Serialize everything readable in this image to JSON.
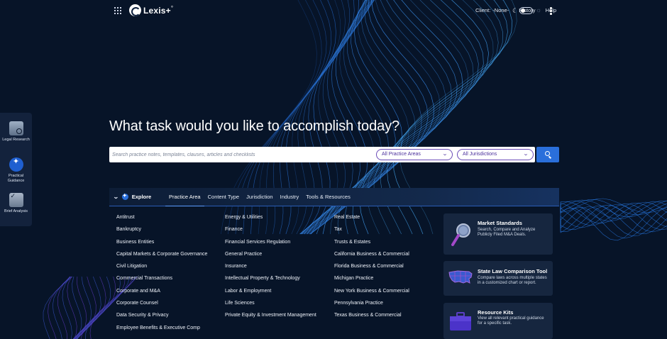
{
  "app": {
    "name": "Lexis+",
    "logo_sup": "°"
  },
  "topnav": {
    "client_label": "Client:",
    "client_value": "-None-",
    "history": "History",
    "help": "Help"
  },
  "rail": {
    "legal": "Legal Research",
    "practical": "Practical Guidance",
    "brief": "Brief Analysis"
  },
  "hero": {
    "title": "What task would you like to accomplish today?"
  },
  "search": {
    "placeholder": "Search practice notes, templates, clauses, articles and checklists",
    "practice_areas": "All Practice Areas",
    "jurisdictions": "All Jurisdictions"
  },
  "explore": {
    "label": "Explore",
    "tabs": [
      "Practice Area",
      "Content Type",
      "Jurisdiction",
      "Industry",
      "Tools & Resources"
    ]
  },
  "practice_areas": {
    "col1": [
      "Antitrust",
      "Bankruptcy",
      "Business Entities",
      "Capital Markets & Corporate Governance",
      "Civil Litigation",
      "Commercial Transactions",
      "Corporate and M&A",
      "Corporate Counsel",
      "Data Security & Privacy",
      "Employee Benefits & Executive Comp"
    ],
    "col2": [
      "Energy & Utilities",
      "Finance",
      "Financial Services Regulation",
      "General Practice",
      "Insurance",
      "Intellectual Property & Technology",
      "Labor & Employment",
      "Life Sciences",
      "Private Equity & Investment Management"
    ],
    "col3": [
      "Real Estate",
      "Tax",
      "Trusts & Estates",
      "California Business & Commercial",
      "Florida Business & Commercial",
      "Michigan Practice",
      "New York Business & Commercial",
      "Pennsylvania Practice",
      "Texas Business & Commercial"
    ]
  },
  "cards": {
    "market": {
      "title": "Market Standards",
      "desc": "Search, Compare and Analyze Publicly Filed M&A Deals."
    },
    "state": {
      "title": "State Law Comparison Tool",
      "desc": "Compare laws across multiple states in a customized chart or report."
    },
    "kits": {
      "title": "Resource Kits",
      "desc": "View all relevant practical guidance for a specific task."
    }
  },
  "colors": {
    "accent": "#2a6fdb",
    "background": "#071428",
    "select_border": "#6a4bb8"
  }
}
